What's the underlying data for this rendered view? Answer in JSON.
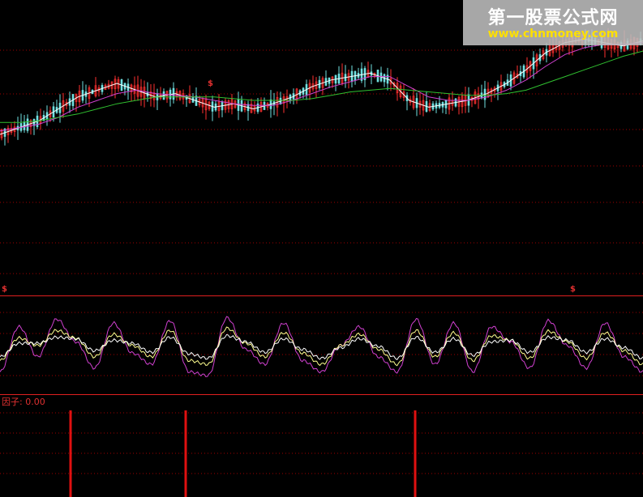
{
  "watermark": {
    "title": "第一股票公式网",
    "url": "www.chnmoney.com"
  },
  "indicator": {
    "label": "因子: 0.00"
  },
  "markers": {
    "dividend_symbol": "$"
  },
  "colors": {
    "background": "#000000",
    "grid": "#a00000",
    "panel_border": "#e02020",
    "candle_up": "#ff3030",
    "candle_down": "#70e0e0",
    "ma_short": "#ffffff",
    "ma_mid": "#d040d0",
    "ma_long": "#30c030",
    "osc_fast": "#d040d0",
    "osc_slow": "#ffff90",
    "osc_mid": "#ffffff",
    "signal_bar": "#e01010"
  },
  "chart_data": [
    {
      "type": "candlestick",
      "panel": "price",
      "series": [
        {
          "color": "#ffffff",
          "values": [
            0.4,
            0.44,
            0.48,
            0.55,
            0.62,
            0.66,
            0.7,
            0.66,
            0.62,
            0.64,
            0.6,
            0.56,
            0.58,
            0.55,
            0.58,
            0.62,
            0.68,
            0.72,
            0.74,
            0.76,
            0.72,
            0.6,
            0.56,
            0.58,
            0.6,
            0.64,
            0.7,
            0.78,
            0.88,
            0.94,
            0.96,
            0.94,
            0.92,
            0.95
          ]
        },
        {
          "color": "#d040d0",
          "values": [
            0.42,
            0.44,
            0.46,
            0.5,
            0.56,
            0.6,
            0.64,
            0.66,
            0.64,
            0.63,
            0.62,
            0.6,
            0.58,
            0.57,
            0.57,
            0.6,
            0.64,
            0.68,
            0.71,
            0.74,
            0.74,
            0.68,
            0.62,
            0.6,
            0.6,
            0.62,
            0.66,
            0.72,
            0.8,
            0.87,
            0.91,
            0.93,
            0.93,
            0.94
          ]
        },
        {
          "color": "#30c030",
          "values": [
            0.47,
            0.47,
            0.48,
            0.5,
            0.52,
            0.55,
            0.58,
            0.6,
            0.62,
            0.62,
            0.62,
            0.62,
            0.61,
            0.6,
            0.6,
            0.6,
            0.61,
            0.63,
            0.65,
            0.66,
            0.67,
            0.66,
            0.65,
            0.64,
            0.63,
            0.63,
            0.64,
            0.66,
            0.7,
            0.74,
            0.78,
            0.82,
            0.86,
            0.89
          ]
        }
      ]
    },
    {
      "type": "line",
      "panel": "oscillator",
      "series": [
        {
          "color": "#d040d0",
          "values": [
            0.2,
            0.8,
            0.4,
            0.9,
            0.6,
            0.25,
            0.85,
            0.45,
            0.3,
            0.88,
            0.2,
            0.15,
            0.92,
            0.5,
            0.3,
            0.85,
            0.35,
            0.2,
            0.55,
            0.8,
            0.4,
            0.2,
            0.9,
            0.3,
            0.85,
            0.2,
            0.8,
            0.6,
            0.25,
            0.88,
            0.55,
            0.25,
            0.85,
            0.4,
            0.2
          ]
        },
        {
          "color": "#ffff90",
          "values": [
            0.35,
            0.65,
            0.55,
            0.75,
            0.65,
            0.4,
            0.7,
            0.55,
            0.4,
            0.75,
            0.35,
            0.3,
            0.78,
            0.58,
            0.4,
            0.72,
            0.45,
            0.3,
            0.55,
            0.7,
            0.5,
            0.3,
            0.75,
            0.4,
            0.72,
            0.35,
            0.68,
            0.62,
            0.38,
            0.74,
            0.6,
            0.38,
            0.72,
            0.48,
            0.3
          ]
        },
        {
          "color": "#ffffff",
          "values": [
            0.4,
            0.58,
            0.58,
            0.66,
            0.64,
            0.48,
            0.62,
            0.58,
            0.46,
            0.66,
            0.44,
            0.38,
            0.68,
            0.6,
            0.46,
            0.64,
            0.5,
            0.38,
            0.52,
            0.64,
            0.54,
            0.38,
            0.66,
            0.46,
            0.64,
            0.42,
            0.6,
            0.62,
            0.46,
            0.66,
            0.62,
            0.46,
            0.64,
            0.52,
            0.38
          ]
        }
      ]
    },
    {
      "type": "bar",
      "panel": "signal",
      "x": [
        87,
        229,
        512
      ],
      "values": [
        1,
        1,
        1
      ]
    }
  ]
}
